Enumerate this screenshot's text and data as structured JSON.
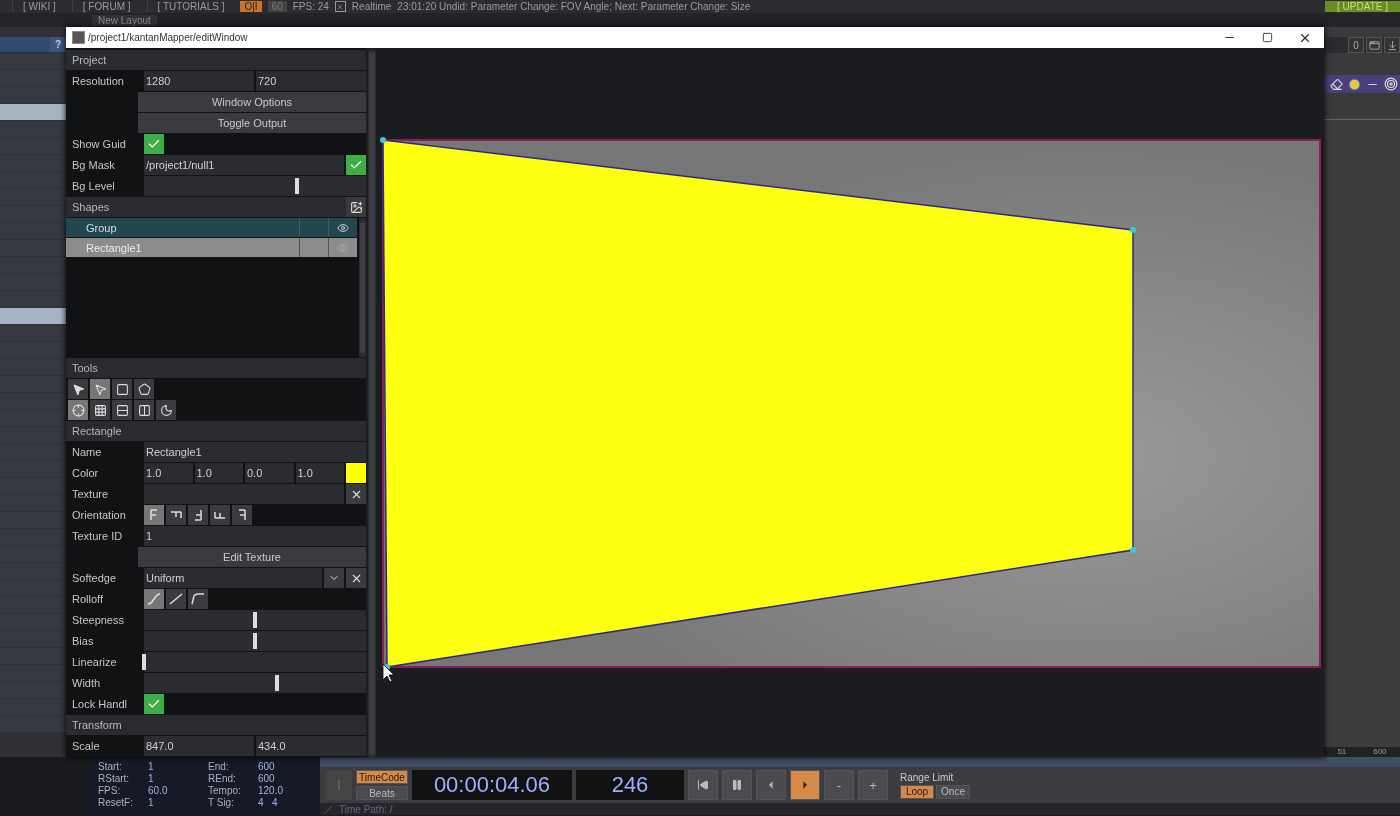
{
  "top_bar": {
    "links": [
      "[ WIKI ]",
      "[ FORUM ]",
      "[ TUTORIALS ]"
    ],
    "toggle": "O|I",
    "rate": "60",
    "fps": "FPS:  24",
    "realtime": {
      "label": "Realtime",
      "checked": true
    },
    "status": "23:01:20 Undid: Parameter Change: FOV Angle; Next: Parameter Change: Size",
    "update": "[ UPDATE ]"
  },
  "layout_tab": "New Layout",
  "help_button": "?",
  "right_panel": {
    "counter": "0",
    "ruler": [
      "51",
      "600"
    ]
  },
  "window": {
    "title": "/project1/kantanMapper/editWindow"
  },
  "project": {
    "header": "Project",
    "resolution": {
      "label": "Resolution",
      "values": [
        "1280",
        "720"
      ]
    },
    "buttons": [
      "Window Options",
      "Toggle Output"
    ],
    "show_guide": {
      "label": "Show Guid",
      "checked": true
    },
    "bg_mask": {
      "label": "Bg Mask",
      "value": "/project1/null1",
      "checked": true
    },
    "bg_level": {
      "label": "Bg Level",
      "level": 0.69
    }
  },
  "shapes": {
    "header": "Shapes",
    "items": [
      {
        "name": "Group",
        "kind": "group",
        "selected": false
      },
      {
        "name": "Rectangle1",
        "kind": "shape",
        "selected": true
      }
    ]
  },
  "tools": {
    "header": "Tools",
    "items": [
      {
        "kind": "select",
        "selected": false
      },
      {
        "kind": "direct",
        "selected": true
      },
      {
        "kind": "rectangle",
        "selected": false
      },
      {
        "kind": "polygon",
        "selected": false
      },
      {
        "kind": "transform",
        "selected": true
      },
      {
        "kind": "grid",
        "selected": false
      },
      {
        "kind": "rows",
        "selected": false
      },
      {
        "kind": "columns",
        "selected": false
      },
      {
        "kind": "curve",
        "selected": false
      }
    ]
  },
  "rectangle": {
    "header": "Rectangle",
    "name": {
      "label": "Name",
      "value": "Rectangle1"
    },
    "color": {
      "label": "Color",
      "values": [
        "1.0",
        "1.0",
        "0.0",
        "1.0"
      ]
    },
    "texture": {
      "label": "Texture"
    },
    "orientation": {
      "label": "Orientation",
      "options": [
        {
          "kind": "r0",
          "selected": true
        },
        {
          "kind": "r90",
          "selected": false
        },
        {
          "kind": "r180",
          "selected": false
        },
        {
          "kind": "r270",
          "selected": false
        },
        {
          "kind": "mirror",
          "selected": false
        }
      ]
    },
    "texture_id": {
      "label": "Texture ID",
      "value": "1"
    },
    "edit_texture": "Edit Texture",
    "softedge": {
      "label": "Softedge",
      "value": "Uniform"
    },
    "rolloff": {
      "label": "Rolloff",
      "options": [
        {
          "kind": "smooth",
          "selected": true
        },
        {
          "kind": "linear",
          "selected": false
        },
        {
          "kind": "ease",
          "selected": false
        }
      ]
    },
    "sliders": [
      {
        "label": "Steepness",
        "level": 0.5
      },
      {
        "label": "Bias",
        "level": 0.5
      },
      {
        "label": "Linearize",
        "level": 0
      },
      {
        "label": "Width",
        "level": 0.6
      }
    ],
    "lock_handles": {
      "label": "Lock Handl",
      "checked": true
    }
  },
  "transform": {
    "header": "Transform",
    "scale": {
      "label": "Scale",
      "values": [
        "847.0",
        "434.0"
      ]
    }
  },
  "timeline": {
    "info": [
      {
        "label": "Start:",
        "value": "1"
      },
      {
        "label": "End:",
        "value": "600"
      },
      {
        "label": "RStart:",
        "value": "1"
      },
      {
        "label": "REnd:",
        "value": "600"
      },
      {
        "label": "FPS:",
        "value": "60.0"
      },
      {
        "label": "Tempo:",
        "value": "120.0"
      },
      {
        "label": "ResetF:",
        "value": "1"
      },
      {
        "label": "T Sig:",
        "value": "4   4"
      }
    ],
    "modes": [
      {
        "label": "TimeCode",
        "selected": true
      },
      {
        "label": "Beats",
        "selected": false
      }
    ],
    "timecode": "00:00:04.06",
    "frame": "246",
    "transport": [
      {
        "kind": "start",
        "selected": false
      },
      {
        "kind": "pause",
        "selected": false
      },
      {
        "kind": "back",
        "selected": false
      },
      {
        "kind": "play",
        "selected": true
      },
      {
        "kind": "text",
        "label": "-",
        "selected": false
      },
      {
        "kind": "text",
        "label": "+",
        "selected": false
      }
    ],
    "range_limit": "Range Limit",
    "range_modes": [
      {
        "label": "Loop",
        "selected": true
      },
      {
        "label": "Once",
        "selected": false
      }
    ],
    "time_path": "Time Path: /"
  }
}
